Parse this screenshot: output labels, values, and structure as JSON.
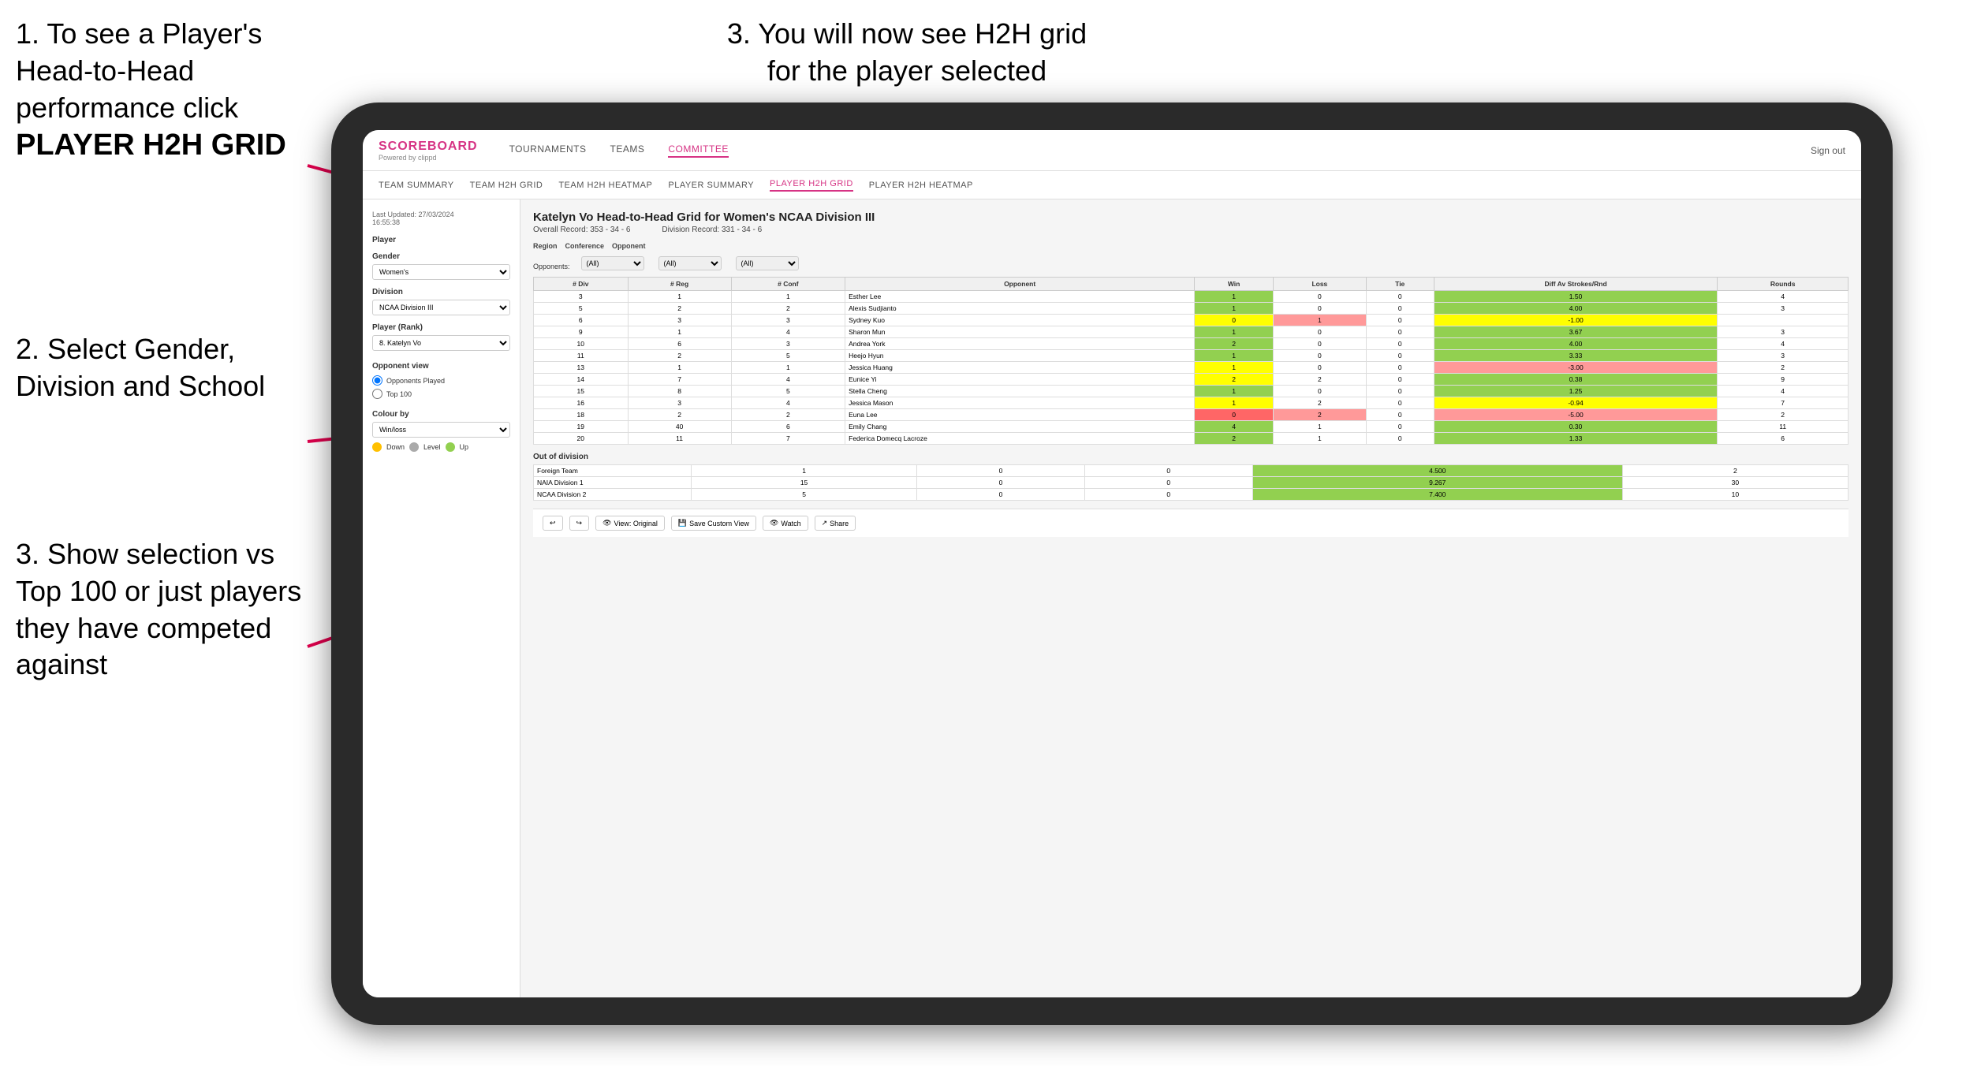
{
  "instructions": {
    "top_left_1": "1. To see a Player's Head-to-Head performance click",
    "top_left_2": "PLAYER H2H GRID",
    "top_right": "3. You will now see H2H grid for the player selected",
    "mid_left_header": "2. Select Gender, Division and School",
    "bottom_left": "3. Show selection vs Top 100 or just players they have competed against"
  },
  "navbar": {
    "logo": "SCOREBOARD",
    "powered_by": "Powered by clippd",
    "menu": [
      "TOURNAMENTS",
      "TEAMS",
      "COMMITTEE"
    ],
    "sign_out": "Sign out"
  },
  "sub_navbar": {
    "items": [
      "TEAM SUMMARY",
      "TEAM H2H GRID",
      "TEAM H2H HEATMAP",
      "PLAYER SUMMARY",
      "PLAYER H2H GRID",
      "PLAYER H2H HEATMAP"
    ]
  },
  "sidebar": {
    "update_label": "Last Updated: 27/03/2024",
    "update_time": "16:55:38",
    "player_label": "Player",
    "gender_label": "Gender",
    "gender_value": "Women's",
    "division_label": "Division",
    "division_value": "NCAA Division III",
    "player_rank_label": "Player (Rank)",
    "player_rank_value": "8. Katelyn Vo",
    "opponent_view_label": "Opponent view",
    "opponent_played": "Opponents Played",
    "top_100": "Top 100",
    "colour_by_label": "Colour by",
    "colour_by_value": "Win/loss",
    "legend": {
      "down": "Down",
      "level": "Level",
      "up": "Up"
    }
  },
  "grid": {
    "title": "Katelyn Vo Head-to-Head Grid for Women's NCAA Division III",
    "overall_record_label": "Overall Record:",
    "overall_record": "353 - 34 - 6",
    "division_record_label": "Division Record:",
    "division_record": "331 - 34 - 6",
    "region_label": "Region",
    "conference_label": "Conference",
    "opponent_label": "Opponent",
    "opponents_label": "Opponents:",
    "opponents_value": "(All)",
    "conference_value": "(All)",
    "opponent_filter_value": "(All)",
    "table_headers": [
      "# Div",
      "# Reg",
      "# Conf",
      "Opponent",
      "Win",
      "Loss",
      "Tie",
      "Diff Av Strokes/Rnd",
      "Rounds"
    ],
    "rows": [
      {
        "div": 3,
        "reg": 1,
        "conf": 1,
        "opponent": "Esther Lee",
        "win": 1,
        "loss": 0,
        "tie": 0,
        "diff": 1.5,
        "rounds": 4,
        "win_color": "green"
      },
      {
        "div": 5,
        "reg": 2,
        "conf": 2,
        "opponent": "Alexis Sudjianto",
        "win": 1,
        "loss": 0,
        "tie": 0,
        "diff": 4.0,
        "rounds": 3,
        "win_color": "green"
      },
      {
        "div": 6,
        "reg": 3,
        "conf": 3,
        "opponent": "Sydney Kuo",
        "win": 0,
        "loss": 1,
        "tie": 0,
        "diff": -1.0,
        "rounds": "",
        "win_color": "yellow"
      },
      {
        "div": 9,
        "reg": 1,
        "conf": 4,
        "opponent": "Sharon Mun",
        "win": 1,
        "loss": 0,
        "tie": 0,
        "diff": 3.67,
        "rounds": 3,
        "win_color": "green"
      },
      {
        "div": 10,
        "reg": 6,
        "conf": 3,
        "opponent": "Andrea York",
        "win": 2,
        "loss": 0,
        "tie": 0,
        "diff": 4.0,
        "rounds": 4,
        "win_color": "green"
      },
      {
        "div": 11,
        "reg": 2,
        "conf": 5,
        "opponent": "Heejo Hyun",
        "win": 1,
        "loss": 0,
        "tie": 0,
        "diff": 3.33,
        "rounds": 3,
        "win_color": "green"
      },
      {
        "div": 13,
        "reg": 1,
        "conf": 1,
        "opponent": "Jessica Huang",
        "win": 1,
        "loss": 0,
        "tie": 0,
        "diff": -3.0,
        "rounds": 2,
        "win_color": "yellow"
      },
      {
        "div": 14,
        "reg": 7,
        "conf": 4,
        "opponent": "Eunice Yi",
        "win": 2,
        "loss": 2,
        "tie": 0,
        "diff": 0.38,
        "rounds": 9,
        "win_color": "yellow"
      },
      {
        "div": 15,
        "reg": 8,
        "conf": 5,
        "opponent": "Stella Cheng",
        "win": 1,
        "loss": 0,
        "tie": 0,
        "diff": 1.25,
        "rounds": 4,
        "win_color": "green"
      },
      {
        "div": 16,
        "reg": 3,
        "conf": 4,
        "opponent": "Jessica Mason",
        "win": 1,
        "loss": 2,
        "tie": 0,
        "diff": -0.94,
        "rounds": 7,
        "win_color": "yellow"
      },
      {
        "div": 18,
        "reg": 2,
        "conf": 2,
        "opponent": "Euna Lee",
        "win": 0,
        "loss": 2,
        "tie": 0,
        "diff": -5.0,
        "rounds": 2,
        "win_color": "red"
      },
      {
        "div": 19,
        "reg": 40,
        "conf": 6,
        "opponent": "Emily Chang",
        "win": 4,
        "loss": 1,
        "tie": 0,
        "diff": 0.3,
        "rounds": 11,
        "win_color": "green"
      },
      {
        "div": 20,
        "reg": 11,
        "conf": 7,
        "opponent": "Federica Domecq Lacroze",
        "win": 2,
        "loss": 1,
        "tie": 0,
        "diff": 1.33,
        "rounds": 6,
        "win_color": "green"
      }
    ],
    "out_of_division_label": "Out of division",
    "out_of_division_rows": [
      {
        "opponent": "Foreign Team",
        "win": 1,
        "loss": 0,
        "tie": 0,
        "diff": 4.5,
        "rounds": 2
      },
      {
        "opponent": "NAIA Division 1",
        "win": 15,
        "loss": 0,
        "tie": 0,
        "diff": 9.267,
        "rounds": 30
      },
      {
        "opponent": "NCAA Division 2",
        "win": 5,
        "loss": 0,
        "tie": 0,
        "diff": 7.4,
        "rounds": 10
      }
    ]
  },
  "toolbar": {
    "view_original": "View: Original",
    "save_custom_view": "Save Custom View",
    "watch": "Watch",
    "share": "Share"
  }
}
